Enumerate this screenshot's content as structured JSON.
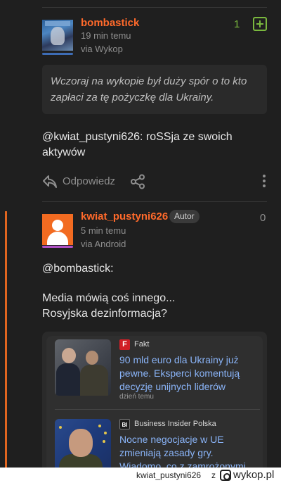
{
  "comment1": {
    "username": "bombastick",
    "time": "19 min temu",
    "source": "via Wykop",
    "vote_count": "1",
    "quote": "Wczoraj na wykopie był duży spór o to kto zapłaci za tę pożyczkę dla Ukrainy.",
    "body": "@kwiat_pustyni626: roSSja ze swoich aktywów",
    "reply_label": "Odpowiedz"
  },
  "comment2": {
    "username": "kwiat_pustyni626",
    "badge": "Autor",
    "time": "5 min temu",
    "source": "via Android",
    "vote_count": "0",
    "mention": "@bombastick:",
    "line1": "Media mówią coś innego...",
    "line2": "Rosyjska dezinformacja?"
  },
  "news": [
    {
      "source": "Fakt",
      "logo": "F",
      "headline": "90 mld euro dla Ukrainy już pewne. Eksperci komentują decyzję unijnych liderów",
      "ago": "dzień temu"
    },
    {
      "source": "Business Insider Polska",
      "logo": "BI",
      "headline": "Nocne negocjacje w UE zmieniają zasady gry. Wiadomo, co z zamrożonymi..."
    }
  ],
  "footer": {
    "author": "kwiat_pustyni626",
    "z": "z",
    "brand": "wykop.pl"
  },
  "colors": {
    "accent": "#ff6a2b",
    "vote_positive": "#7ab83e",
    "link": "#8ab4f8",
    "background": "#1f1f1f"
  }
}
